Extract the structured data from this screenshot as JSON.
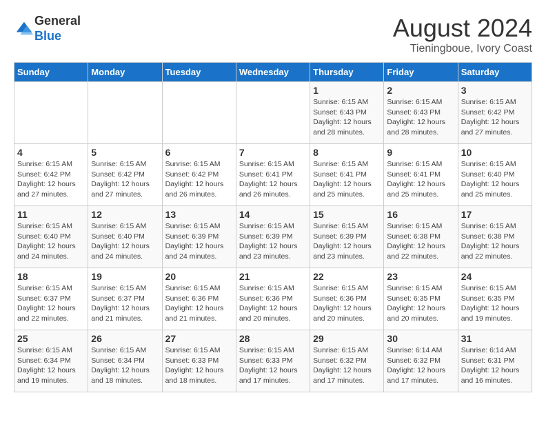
{
  "header": {
    "logo_line1": "General",
    "logo_line2": "Blue",
    "month": "August 2024",
    "location": "Tieningboue, Ivory Coast"
  },
  "weekdays": [
    "Sunday",
    "Monday",
    "Tuesday",
    "Wednesday",
    "Thursday",
    "Friday",
    "Saturday"
  ],
  "weeks": [
    [
      {
        "day": "",
        "info": ""
      },
      {
        "day": "",
        "info": ""
      },
      {
        "day": "",
        "info": ""
      },
      {
        "day": "",
        "info": ""
      },
      {
        "day": "1",
        "info": "Sunrise: 6:15 AM\nSunset: 6:43 PM\nDaylight: 12 hours and 28 minutes."
      },
      {
        "day": "2",
        "info": "Sunrise: 6:15 AM\nSunset: 6:43 PM\nDaylight: 12 hours and 28 minutes."
      },
      {
        "day": "3",
        "info": "Sunrise: 6:15 AM\nSunset: 6:42 PM\nDaylight: 12 hours and 27 minutes."
      }
    ],
    [
      {
        "day": "4",
        "info": "Sunrise: 6:15 AM\nSunset: 6:42 PM\nDaylight: 12 hours and 27 minutes."
      },
      {
        "day": "5",
        "info": "Sunrise: 6:15 AM\nSunset: 6:42 PM\nDaylight: 12 hours and 27 minutes."
      },
      {
        "day": "6",
        "info": "Sunrise: 6:15 AM\nSunset: 6:42 PM\nDaylight: 12 hours and 26 minutes."
      },
      {
        "day": "7",
        "info": "Sunrise: 6:15 AM\nSunset: 6:41 PM\nDaylight: 12 hours and 26 minutes."
      },
      {
        "day": "8",
        "info": "Sunrise: 6:15 AM\nSunset: 6:41 PM\nDaylight: 12 hours and 25 minutes."
      },
      {
        "day": "9",
        "info": "Sunrise: 6:15 AM\nSunset: 6:41 PM\nDaylight: 12 hours and 25 minutes."
      },
      {
        "day": "10",
        "info": "Sunrise: 6:15 AM\nSunset: 6:40 PM\nDaylight: 12 hours and 25 minutes."
      }
    ],
    [
      {
        "day": "11",
        "info": "Sunrise: 6:15 AM\nSunset: 6:40 PM\nDaylight: 12 hours and 24 minutes."
      },
      {
        "day": "12",
        "info": "Sunrise: 6:15 AM\nSunset: 6:40 PM\nDaylight: 12 hours and 24 minutes."
      },
      {
        "day": "13",
        "info": "Sunrise: 6:15 AM\nSunset: 6:39 PM\nDaylight: 12 hours and 24 minutes."
      },
      {
        "day": "14",
        "info": "Sunrise: 6:15 AM\nSunset: 6:39 PM\nDaylight: 12 hours and 23 minutes."
      },
      {
        "day": "15",
        "info": "Sunrise: 6:15 AM\nSunset: 6:39 PM\nDaylight: 12 hours and 23 minutes."
      },
      {
        "day": "16",
        "info": "Sunrise: 6:15 AM\nSunset: 6:38 PM\nDaylight: 12 hours and 22 minutes."
      },
      {
        "day": "17",
        "info": "Sunrise: 6:15 AM\nSunset: 6:38 PM\nDaylight: 12 hours and 22 minutes."
      }
    ],
    [
      {
        "day": "18",
        "info": "Sunrise: 6:15 AM\nSunset: 6:37 PM\nDaylight: 12 hours and 22 minutes."
      },
      {
        "day": "19",
        "info": "Sunrise: 6:15 AM\nSunset: 6:37 PM\nDaylight: 12 hours and 21 minutes."
      },
      {
        "day": "20",
        "info": "Sunrise: 6:15 AM\nSunset: 6:36 PM\nDaylight: 12 hours and 21 minutes."
      },
      {
        "day": "21",
        "info": "Sunrise: 6:15 AM\nSunset: 6:36 PM\nDaylight: 12 hours and 20 minutes."
      },
      {
        "day": "22",
        "info": "Sunrise: 6:15 AM\nSunset: 6:36 PM\nDaylight: 12 hours and 20 minutes."
      },
      {
        "day": "23",
        "info": "Sunrise: 6:15 AM\nSunset: 6:35 PM\nDaylight: 12 hours and 20 minutes."
      },
      {
        "day": "24",
        "info": "Sunrise: 6:15 AM\nSunset: 6:35 PM\nDaylight: 12 hours and 19 minutes."
      }
    ],
    [
      {
        "day": "25",
        "info": "Sunrise: 6:15 AM\nSunset: 6:34 PM\nDaylight: 12 hours and 19 minutes."
      },
      {
        "day": "26",
        "info": "Sunrise: 6:15 AM\nSunset: 6:34 PM\nDaylight: 12 hours and 18 minutes."
      },
      {
        "day": "27",
        "info": "Sunrise: 6:15 AM\nSunset: 6:33 PM\nDaylight: 12 hours and 18 minutes."
      },
      {
        "day": "28",
        "info": "Sunrise: 6:15 AM\nSunset: 6:33 PM\nDaylight: 12 hours and 17 minutes."
      },
      {
        "day": "29",
        "info": "Sunrise: 6:15 AM\nSunset: 6:32 PM\nDaylight: 12 hours and 17 minutes."
      },
      {
        "day": "30",
        "info": "Sunrise: 6:14 AM\nSunset: 6:32 PM\nDaylight: 12 hours and 17 minutes."
      },
      {
        "day": "31",
        "info": "Sunrise: 6:14 AM\nSunset: 6:31 PM\nDaylight: 12 hours and 16 minutes."
      }
    ]
  ]
}
